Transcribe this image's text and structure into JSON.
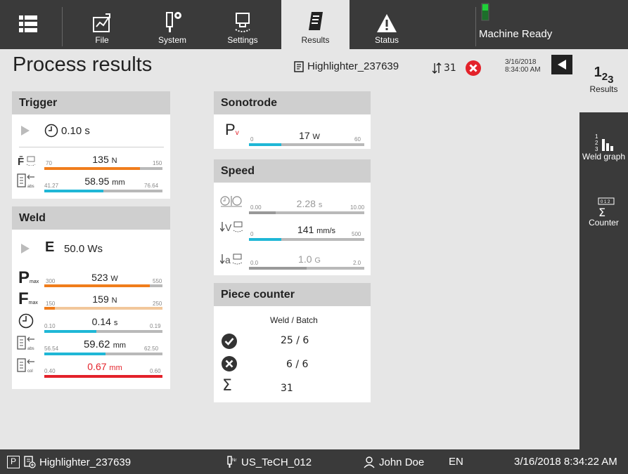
{
  "nav": {
    "menu_icon": "hamburger-icon",
    "file": "File",
    "system": "System",
    "settings": "Settings",
    "results": "Results",
    "status": "Status",
    "machine_status": "Machine Ready"
  },
  "sidebar": {
    "results_label": "Results",
    "weld_graph_label": "Weld graph",
    "counter_label": "Counter"
  },
  "header": {
    "title": "Process results",
    "program": "Highlighter_237639",
    "count": "31",
    "date": "3/16/2018",
    "time": "8:34:00 AM"
  },
  "trigger": {
    "title": "Trigger",
    "time": "0.10 s",
    "force": {
      "min": "70",
      "max": "150",
      "value": "135",
      "unit": "N",
      "fraction": 0.81
    },
    "abs": {
      "min": "41.27",
      "max": "76.64",
      "value": "58.95",
      "unit": "mm",
      "fraction": 0.5
    }
  },
  "weld": {
    "title": "Weld",
    "energy_label": "E",
    "energy": "50.0 Ws",
    "pmax": {
      "min": "300",
      "max": "550",
      "value": "523",
      "unit": "W",
      "fraction": 0.89
    },
    "fmax": {
      "min": "150",
      "max": "250",
      "value": "159",
      "unit": "N",
      "fraction": 0.09
    },
    "time": {
      "min": "0.10",
      "max": "0.19",
      "value": "0.14",
      "unit": "s",
      "fraction": 0.44
    },
    "abs": {
      "min": "56.54",
      "max": "62.50",
      "value": "59.62",
      "unit": "mm",
      "fraction": 0.52
    },
    "col": {
      "min": "0.40",
      "max": "0.60",
      "value": "0.67",
      "unit": "mm",
      "fraction": 1.0
    }
  },
  "sonotrode": {
    "title": "Sonotrode",
    "label": "P",
    "sub": "v",
    "pv": {
      "min": "0",
      "max": "60",
      "value": "17",
      "unit": "W",
      "fraction": 0.28
    }
  },
  "speed": {
    "title": "Speed",
    "t": {
      "min": "0.00",
      "max": "10.00",
      "value": "2.28",
      "unit": "s",
      "fraction": 0.23
    },
    "v": {
      "min": "0",
      "max": "500",
      "value": "141",
      "unit": "mm/s",
      "fraction": 0.28
    },
    "a": {
      "min": "0.0",
      "max": "2.0",
      "value": "1.0",
      "unit": "G",
      "fraction": 0.5
    }
  },
  "counter": {
    "title": "Piece counter",
    "header": "Weld / Batch",
    "ok": "25 / 6",
    "nok": "6 / 6",
    "total": "31"
  },
  "footer": {
    "p": "P",
    "program": "Highlighter_237639",
    "station": "US_TeCH_012",
    "user": "John Doe",
    "lang": "EN",
    "datetime": "3/16/2018 8:34:22 AM"
  },
  "colors": {
    "orange": "#f07d1c",
    "cyan": "#1fb7d6",
    "red": "#e3222a",
    "grey": "#999999"
  }
}
